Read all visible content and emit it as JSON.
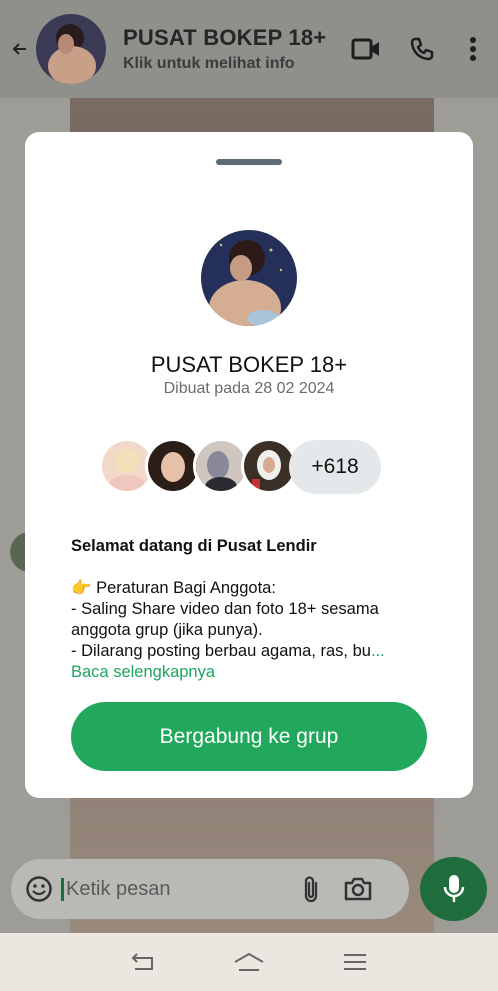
{
  "header": {
    "title": "PUSAT BOKEP 18+",
    "subtitle": "Klik untuk melihat info",
    "icons": [
      "back-arrow-icon",
      "video-call-icon",
      "voice-call-icon",
      "more-vert-icon"
    ]
  },
  "sheet": {
    "group_name": "PUSAT BOKEP 18+",
    "created": "Dibuat pada 28 02 2024",
    "member_more_count": "+618",
    "description_title": "Selamat datang di Pusat Lendir",
    "description_lines": [
      "👉 Peraturan Bagi Anggota:",
      "- Saling Share video dan foto 18+ sesama anggota grup (jika punya).",
      "- Dilarang posting berbau agama, ras, bu"
    ],
    "ellipsis": "...",
    "read_more": "Baca selengkapnya",
    "join_button": "Bergabung ke grup"
  },
  "composer": {
    "placeholder": "Ketik pesan",
    "icons": [
      "emoji-icon",
      "attach-icon",
      "camera-icon",
      "mic-icon"
    ]
  },
  "navbar": {
    "icons": [
      "nav-back-icon",
      "nav-home-icon",
      "nav-menu-icon"
    ]
  },
  "colors": {
    "accent_green": "#21a85c",
    "link_green": "#1da462",
    "mic_green": "#1f6c3d"
  }
}
